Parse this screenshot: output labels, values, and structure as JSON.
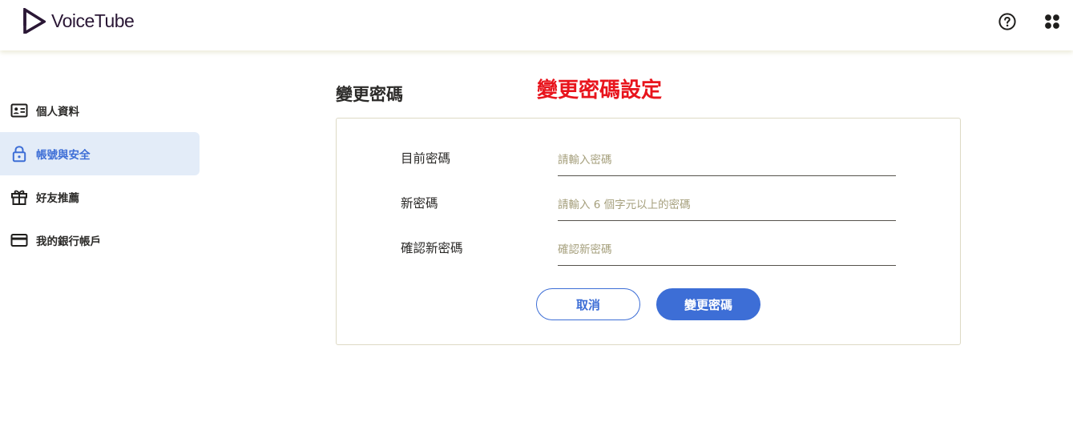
{
  "header": {
    "logo_text": "VoiceTube",
    "help_icon": "help-circle-icon",
    "apps_icon": "apps-grid-icon"
  },
  "sidebar": {
    "items": [
      {
        "label": "個人資料",
        "icon": "id-card-icon",
        "active": false
      },
      {
        "label": "帳號與安全",
        "icon": "lock-icon",
        "active": true
      },
      {
        "label": "好友推薦",
        "icon": "gift-icon",
        "active": false
      },
      {
        "label": "我的銀行帳戶",
        "icon": "credit-card-icon",
        "active": false
      }
    ]
  },
  "main": {
    "title": "變更密碼",
    "annotation": "變更密碼設定",
    "form": {
      "fields": [
        {
          "label": "目前密碼",
          "value": "",
          "placeholder": "請輸入密碼"
        },
        {
          "label": "新密碼",
          "value": "",
          "placeholder": "請輸入 6 個字元以上的密碼"
        },
        {
          "label": "確認新密碼",
          "value": "",
          "placeholder": "確認新密碼"
        }
      ],
      "cancel_label": "取消",
      "submit_label": "變更密碼"
    }
  },
  "colors": {
    "accent": "#3d6ed6",
    "active_bg": "#e3ecf8",
    "annotation": "#e8141c",
    "logo": "#2a1735",
    "placeholder": "#a59f7c"
  }
}
